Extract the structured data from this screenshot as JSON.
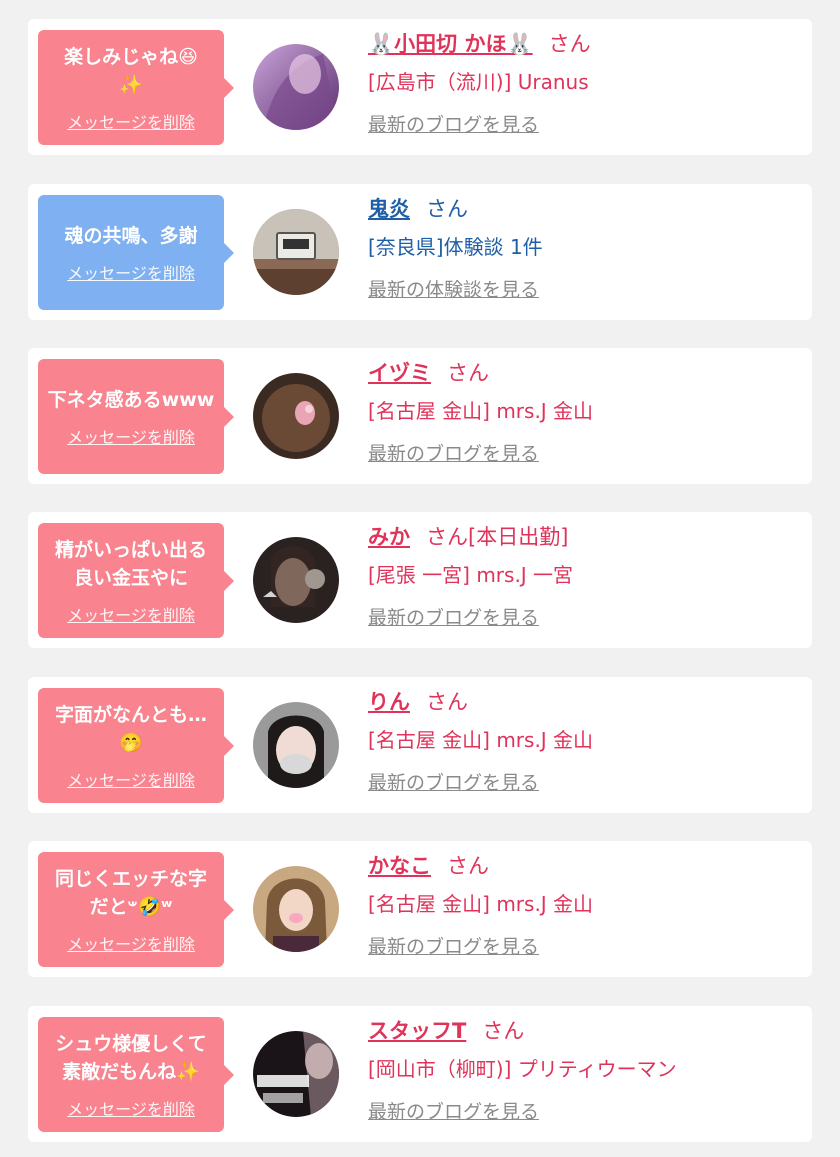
{
  "delete_label": "メッセージを削除",
  "colors": {
    "pink": "#f9848f",
    "blue": "#7fb1f2",
    "name_pink": "#e0335a",
    "name_blue": "#1f5fa8",
    "link_gray": "#8a8a8a"
  },
  "items": [
    {
      "message": "楽しみじゃね😆\n✨",
      "name": "🐰小田切 かほ🐰",
      "suffix": "さん",
      "shop": "[広島市（流川)] Uranus",
      "link": "最新のブログを見る",
      "color": "pink"
    },
    {
      "message": "魂の共鳴、多謝",
      "name": "鬼炎",
      "suffix": "さん",
      "shop": "[奈良県]体験談 1件",
      "link": "最新の体験談を見る",
      "color": "blue"
    },
    {
      "message": "下ネタ感あるwww",
      "name": "イヅミ",
      "suffix": "さん",
      "shop": "[名古屋 金山] mrs.J 金山",
      "link": "最新のブログを見る",
      "color": "pink"
    },
    {
      "message": "精がいっぱい出る\n良い金玉やに",
      "name": "みか",
      "suffix": "さん[本日出勤]",
      "shop": "[尾張 一宮] mrs.J 一宮",
      "link": "最新のブログを見る",
      "color": "pink"
    },
    {
      "message": "字面がなんとも…\n🤭",
      "name": "りん",
      "suffix": "さん",
      "shop": "[名古屋 金山] mrs.J 金山",
      "link": "最新のブログを見る",
      "color": "pink"
    },
    {
      "message": "同じくエッチな字\nだと𐤔🤣ʷ",
      "name": "かなこ",
      "suffix": "さん",
      "shop": "[名古屋 金山] mrs.J 金山",
      "link": "最新のブログを見る",
      "color": "pink"
    },
    {
      "message": "シュウ様優しくて\n素敵だもんね✨",
      "name": "スタッフT",
      "suffix": "さん",
      "shop": "[岡山市（柳町)] プリティウーマン",
      "link": "最新のブログを見る",
      "color": "pink"
    }
  ]
}
